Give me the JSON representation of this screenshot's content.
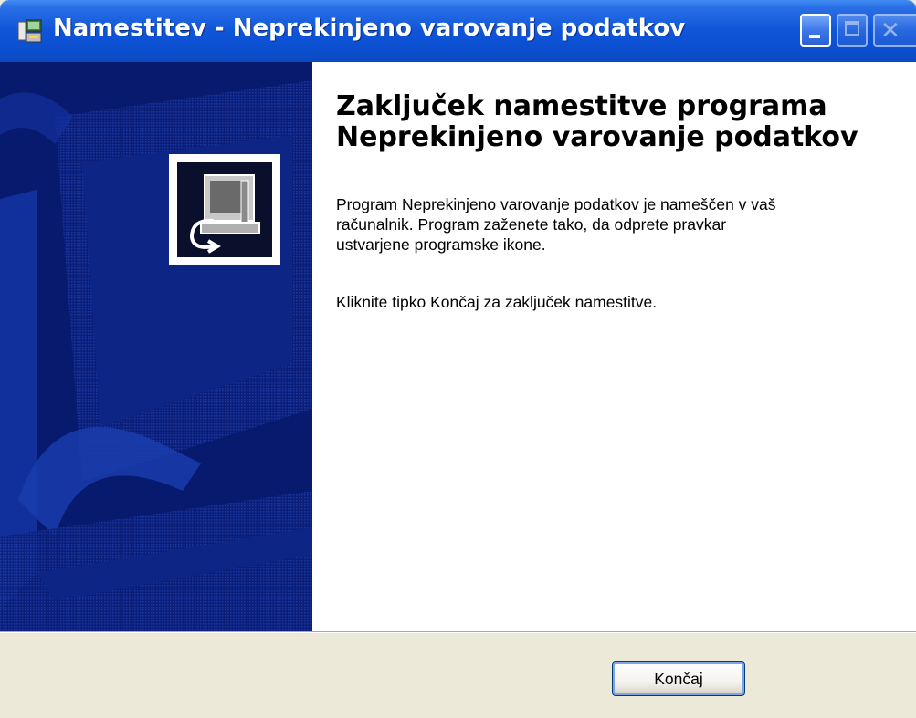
{
  "window": {
    "title": "Namestitev - Neprekinjeno varovanje podatkov",
    "icon": "installer-icon",
    "controls": [
      "minimize-icon",
      "maximize-icon",
      "close-icon"
    ]
  },
  "side_panel": {
    "logo": "computer-setup-icon",
    "colors": {
      "background": "#0b1f7a",
      "accent": "#1a3fb0"
    }
  },
  "content": {
    "heading_line1": "Zaključek namestitve programa",
    "heading_line2": "Neprekinjeno varovanje podatkov",
    "body_line1": "Program Neprekinjeno varovanje podatkov je nameščen v vaš",
    "body_line2": "računalnik. Program zaženete tako, da odprete pravkar",
    "body_line3": "ustvarjene programske ikone.",
    "finish_instruction": "Kliknite tipko Končaj za zaključek namestitve."
  },
  "footer": {
    "finish_label": "Končaj"
  },
  "colors": {
    "titlebar": "#0b4fd0",
    "dialog_bg": "#ece9d8",
    "content_bg": "#ffffff"
  }
}
